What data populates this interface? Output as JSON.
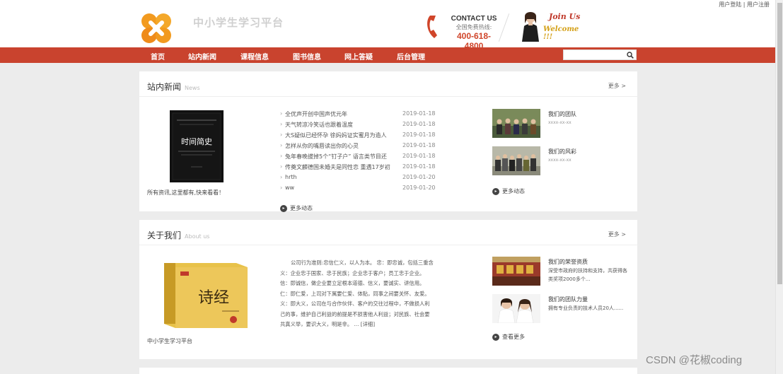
{
  "header": {
    "login_link": "用户登陆",
    "link_separator": "|",
    "register_link": "用户注册",
    "site_name": "中小学生学习平台",
    "contact_title": "CONTACT US",
    "contact_sub": "全国免费热线:",
    "contact_phone": "400-618-4800",
    "join_us": "Join Us",
    "welcome": "Welcome !!!"
  },
  "nav": {
    "items": [
      "首页",
      "站内新闻",
      "课程信息",
      "图书信息",
      "网上答疑",
      "后台管理"
    ],
    "search_placeholder": ""
  },
  "news_section": {
    "title": "站内新闻",
    "title_en": "News",
    "more": "更多 >",
    "book_title": "时间简史",
    "caption": "所有资讯,这里都有,快来看看！",
    "items": [
      {
        "title": "全优声开创中国声优元年",
        "date": "2019-01-18"
      },
      {
        "title": "天气转凉冷笑话也跟着温度",
        "date": "2019-01-18"
      },
      {
        "title": "大S疑似已经怀孕 徐妈妈证实蜜月为造人",
        "date": "2019-01-18"
      },
      {
        "title": "怎样从你的嘴唇读出你的心灵",
        "date": "2019-01-18"
      },
      {
        "title": "兔年春晚拔掉5个“钉子户” 语言类节目还",
        "date": "2019-01-18"
      },
      {
        "title": "传奠文麟德国未婚夫是同性恋 重遇17岁初",
        "date": "2019-01-18"
      },
      {
        "title": "hrth",
        "date": "2019-01-20"
      },
      {
        "title": "ww",
        "date": "2019-01-20"
      }
    ],
    "more_news": "更多动态",
    "side": [
      {
        "name": "我们的团队",
        "sub": "xxxx-xx-xx"
      },
      {
        "name": "我们的风彩",
        "sub": "xxxx-xx-xx"
      }
    ],
    "side_more": "更多动态"
  },
  "about_section": {
    "title": "关于我们",
    "title_en": "About us",
    "more": "更多 >",
    "book_title": "诗经",
    "caption": "中小学生学习平台",
    "text": "公司行为准则:忠信仁义，以人为本。 忠：即忠诚，包括三重含义：企业忠于国家、忠于民族；企业忠于客户；员工忠于企业。 信：即诚信，做企业要立足根本道德、信义，要诚实、讲信用。 仁：即仁爱，上司对下属要仁爱、体贴，同事之间要关怀、友爱。 义：即大义，公司在与合作伙伴、客户的交往过程中，不做损人利己的事，维护自己利益的前提是不损害他人利益；对民族、社会要共真义举，要识大义，明是非。 ...  [详细]",
    "side": [
      {
        "name": "我们的荣誉资质",
        "desc": "深受市政府的扶持和支持，共获得各类奖项2000多个..."
      },
      {
        "name": "我们的团队力量",
        "desc": "拥有专业负责的技术人员20人......"
      }
    ],
    "side_more": "查看更多"
  },
  "watermark": "CSDN @花椒coding"
}
